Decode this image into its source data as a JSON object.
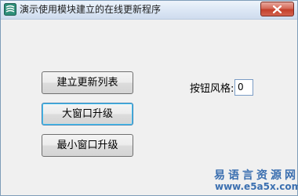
{
  "window": {
    "title": "演示使用模块建立的在线更新程序"
  },
  "buttons": {
    "create_list": "建立更新列表",
    "large_upgrade": "大窗口升级",
    "min_upgrade": "最小窗口升级"
  },
  "button_style": {
    "label": "按钮风格:",
    "value": "0"
  },
  "watermark": {
    "site_name": "易语言资源网",
    "url": "www.e5a5x.com"
  },
  "colors": {
    "close_button": "#c43f2b",
    "watermark": "#3b6fb0",
    "focus_ring": "#48c8f8"
  }
}
